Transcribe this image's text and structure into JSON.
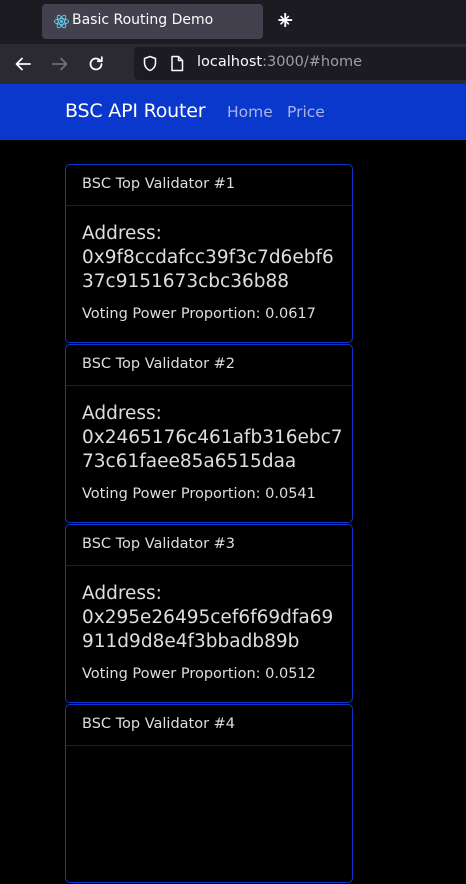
{
  "browser": {
    "tab_title": "Basic Routing Demo",
    "tab_close": "✕",
    "new_tab": "+",
    "url_host": "localhost",
    "url_rest": ":3000/#home"
  },
  "app": {
    "brand": "BSC API Router",
    "nav_links": [
      "Home",
      "Price"
    ]
  },
  "validators": [
    {
      "header": "BSC Top Validator #1",
      "address_label": "Address:",
      "address": "0x9f8ccdafcc39f3c7d6ebf637c9151673cbc36b88",
      "power_text": "Voting Power Proportion: 0.0617"
    },
    {
      "header": "BSC Top Validator #2",
      "address_label": "Address:",
      "address": "0x2465176c461afb316ebc773c61faee85a6515daa",
      "power_text": "Voting Power Proportion: 0.0541"
    },
    {
      "header": "BSC Top Validator #3",
      "address_label": "Address:",
      "address": "0x295e26495cef6f69dfa69911d9d8e4f3bbadb89b",
      "power_text": "Voting Power Proportion: 0.0512"
    },
    {
      "header": "BSC Top Validator #4",
      "address_label": "",
      "address": "",
      "power_text": ""
    }
  ],
  "colors": {
    "navbar": "#0a37cc",
    "card_border": "#0a37cc",
    "page_bg": "#000000"
  }
}
